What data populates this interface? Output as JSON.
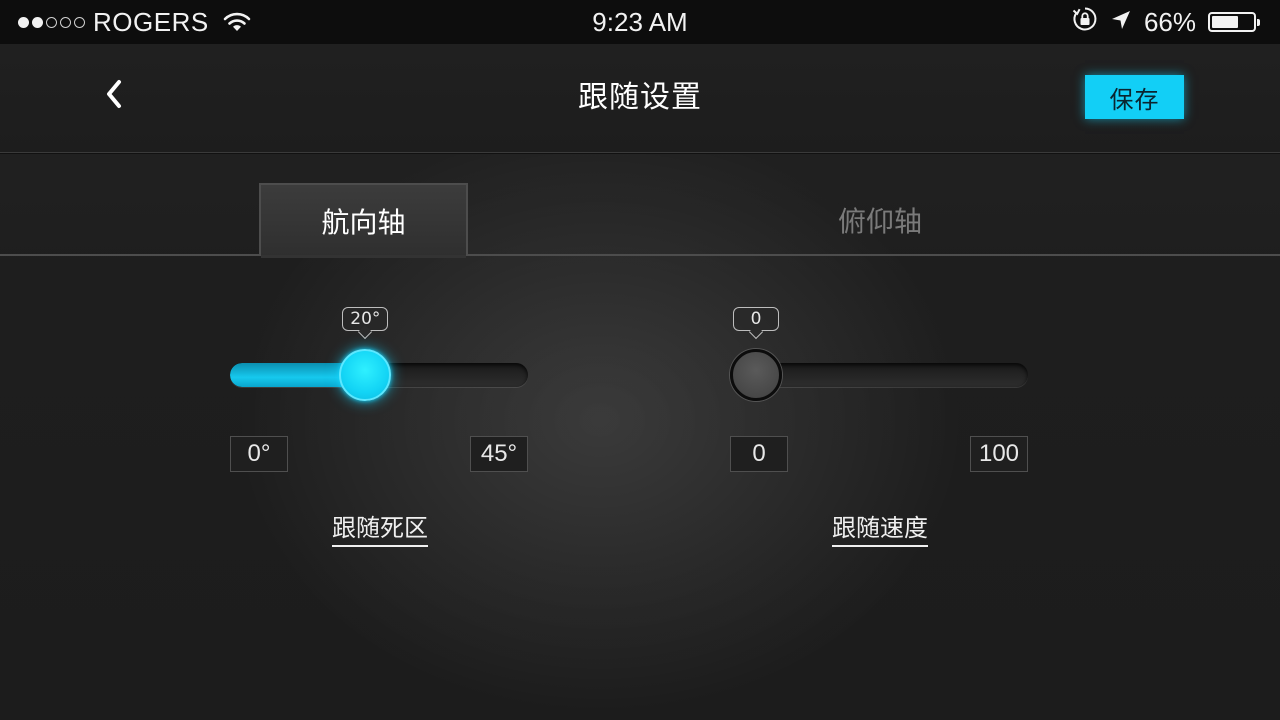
{
  "status_bar": {
    "signal": {
      "filled": 2,
      "total": 5
    },
    "carrier": "ROGERS",
    "time": "9:23 AM",
    "battery_percent_text": "66%",
    "battery_level": 0.66,
    "icons": [
      "wifi-icon",
      "rotation-lock-icon",
      "location-arrow-icon",
      "battery-icon"
    ]
  },
  "nav": {
    "back_icon": "chevron-left-icon",
    "title": "跟随设置",
    "save_label": "保存"
  },
  "tabs": [
    {
      "label": "航向轴",
      "active": true
    },
    {
      "label": "俯仰轴",
      "active": false
    }
  ],
  "sliders": [
    {
      "label": "跟随死区",
      "value": 20,
      "value_text": "20°",
      "min": 0,
      "max": 45,
      "min_label": "0°",
      "max_label": "45°",
      "active": true
    },
    {
      "label": "跟随速度",
      "value": 0,
      "value_text": "0",
      "min": 0,
      "max": 100,
      "min_label": "0",
      "max_label": "100",
      "active": false
    }
  ],
  "colors": {
    "accent": "#12cff6",
    "background": "#1e1e1e",
    "status_bar": "#0d0d0d",
    "inactive_tab_text": "#7a7a7a"
  }
}
